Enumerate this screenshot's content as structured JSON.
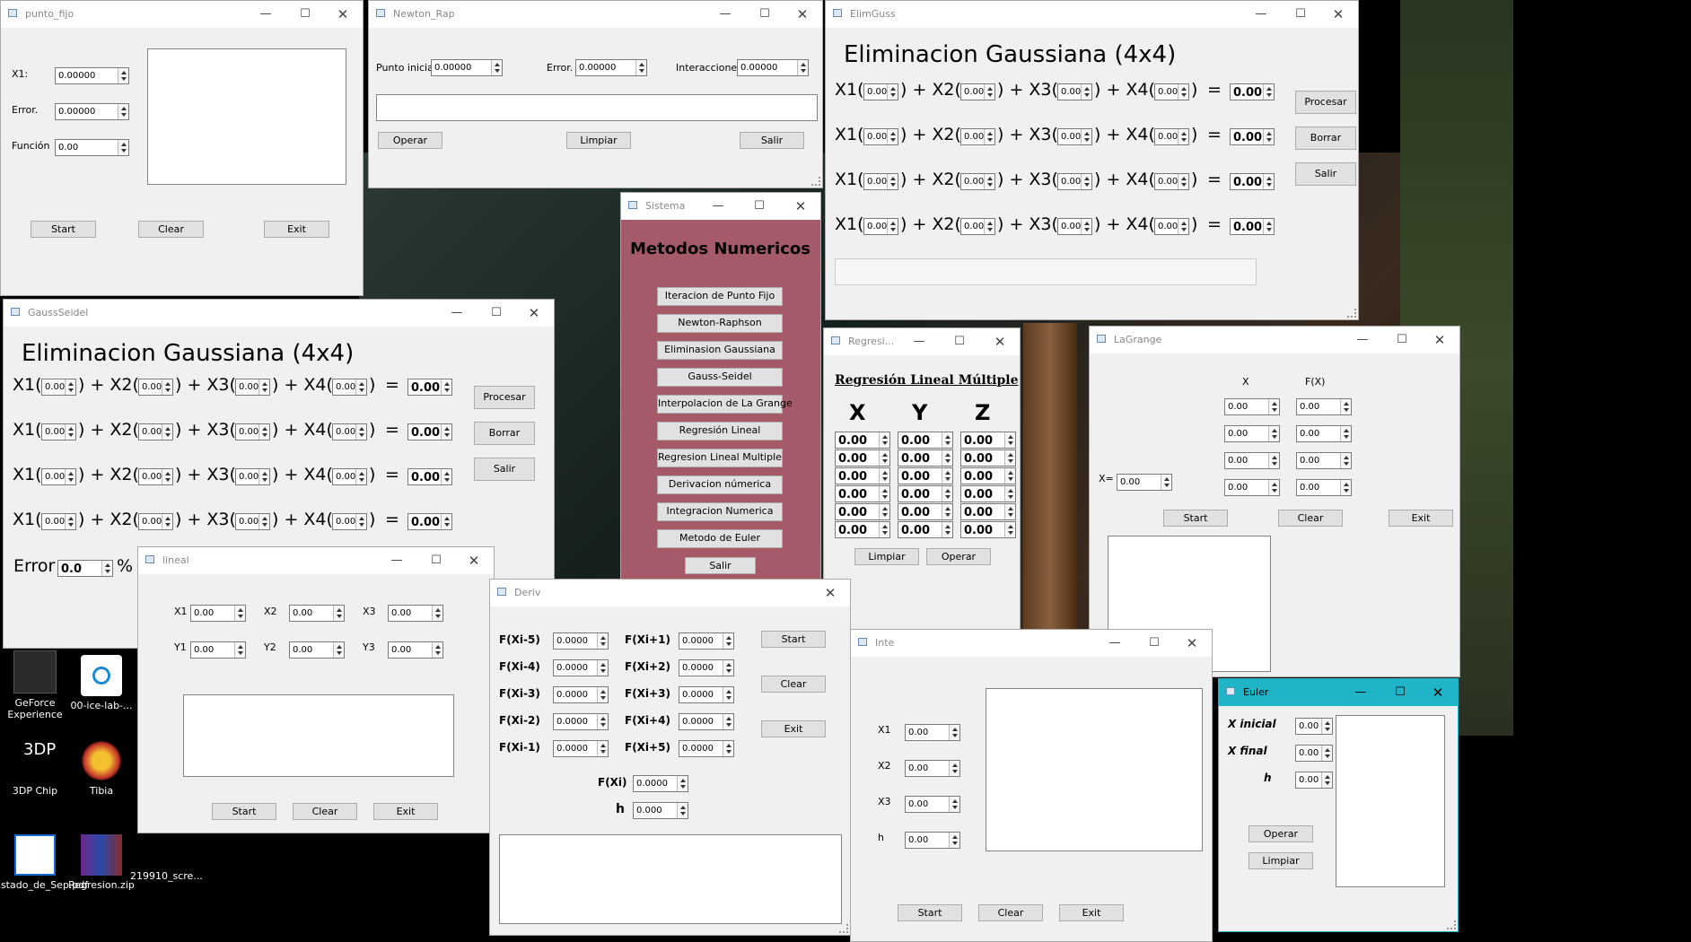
{
  "colors": {
    "sistema_bg": "#a55a6a",
    "euler_titlebar": "#1fb4c8",
    "window_bg": "#f0f0f0",
    "desktop": "#000000"
  },
  "punto_fijo": {
    "title": "punto_fijo",
    "x1_label": "X1:",
    "x1_value": "0.00000",
    "error_label": "Error.",
    "error_value": "0.00000",
    "funcion_label": "Función",
    "funcion_value": "0.00",
    "start": "Start",
    "clear": "Clear",
    "exit": "Exit"
  },
  "newton": {
    "title": "Newton_Rap",
    "punto_label": "Punto inicial",
    "punto_value": "0.00000",
    "error_label": "Error.",
    "error_value": "0.00000",
    "inter_label": "Interacciones",
    "inter_value": "0.00000",
    "operar": "Operar",
    "limpiar": "Limpiar",
    "salir": "Salir"
  },
  "elimguss": {
    "title": "ElimGuss",
    "heading": "Eliminacion Gaussiana (4x4)",
    "coef": "0.00",
    "result": "0.00",
    "procesar": "Procesar",
    "borrar": "Borrar",
    "salir": "Salir",
    "rows": [
      {
        "a": "X1(",
        "b": ") + X2(",
        "c": ") + X3(",
        "d": ") + X4(",
        "e": ")",
        "f": "="
      },
      {
        "a": "X1(",
        "b": ") + X2(",
        "c": ") + X3(",
        "d": ") + X4(",
        "e": ")",
        "f": "="
      },
      {
        "a": "X1(",
        "b": ") + X2(",
        "c": ") + X3(",
        "d": ") + X4(",
        "e": ")",
        "f": "="
      },
      {
        "a": "X1(",
        "b": ") + X2(",
        "c": ") + X3(",
        "d": ") + X4(",
        "e": ")",
        "f": "="
      }
    ]
  },
  "gauss_seidel": {
    "title": "GaussSeidel",
    "heading": "Eliminacion Gaussiana (4x4)",
    "coef": "0.00",
    "result": "0.00",
    "procesar": "Procesar",
    "borrar": "Borrar",
    "salir": "Salir",
    "error_label": "Error",
    "error_value": "0.0",
    "percent": "%",
    "rows": [
      {
        "a": "X1(",
        "b": ") + X2(",
        "c": ") + X3(",
        "d": ") + X4(",
        "e": ")",
        "f": "="
      },
      {
        "a": "X1(",
        "b": ") + X2(",
        "c": ") + X3(",
        "d": ") + X4(",
        "e": ")",
        "f": "="
      },
      {
        "a": "X1(",
        "b": ") + X2(",
        "c": ") + X3(",
        "d": ") + X4(",
        "e": ")",
        "f": "="
      },
      {
        "a": "X1(",
        "b": ") + X2(",
        "c": ") + X3(",
        "d": ") + X4(",
        "e": ")",
        "f": "="
      }
    ]
  },
  "sistema": {
    "title": "Sistema",
    "heading": "Metodos Numericos",
    "buttons": [
      "Iteracion de Punto Fijo",
      "Newton-Raphson",
      "Eliminasion Gaussiana",
      "Gauss-Seidel",
      "Interpolacion de La Grange",
      "Regresión Lineal",
      "Regresion Lineal Multiple",
      "Derivacion númerica",
      "Integracion Numerica",
      "Metodo de Euler"
    ],
    "salir": "Salir"
  },
  "regresion": {
    "title": "Regresi...",
    "heading": "Regresión Lineal Múltiple",
    "cols": [
      "X",
      "Y",
      "Z"
    ],
    "cell": "0.00",
    "limpiar": "Limpiar",
    "operar": "Operar"
  },
  "lagrange": {
    "title": "LaGrange",
    "x_header": "X",
    "fx_header": "F(X)",
    "cell": "0.00",
    "xeq_label": "X=",
    "xeq_value": "0.00",
    "start": "Start",
    "clear": "Clear",
    "exit": "Exit"
  },
  "lineal": {
    "title": "lineal",
    "x1": "X1",
    "x2": "X2",
    "x3": "X3",
    "y1": "Y1",
    "y2": "Y2",
    "y3": "Y3",
    "cell": "0.00",
    "start": "Start",
    "clear": "Clear",
    "exit": "Exit"
  },
  "deriv": {
    "title": "Deriv",
    "left": [
      "F(Xi-5)",
      "F(Xi-4)",
      "F(Xi-3)",
      "F(Xi-2)",
      "F(Xi-1)"
    ],
    "right": [
      "F(Xi+1)",
      "F(Xi+2)",
      "F(Xi+3)",
      "F(Xi+4)",
      "F(Xi+5)"
    ],
    "cell": "0.0000",
    "fxi_label": "F(Xi)",
    "fxi_value": "0.0000",
    "h_label": "h",
    "h_value": "0.000",
    "start": "Start",
    "clear": "Clear",
    "exit": "Exit"
  },
  "inte": {
    "title": "Inte",
    "x1": "X1",
    "x2": "X2",
    "x3": "X3",
    "h": "h",
    "cell": "0.00",
    "start": "Start",
    "clear": "Clear",
    "exit": "Exit"
  },
  "euler": {
    "title": "Euler",
    "xini_label": "X inicial",
    "xfin_label": "X final",
    "h_label": "h",
    "cell": "0.00",
    "operar": "Operar",
    "limpiar": "Limpiar"
  },
  "desktop": {
    "icons": [
      {
        "label": "GeForce Experience",
        "icon": "geforce-icon"
      },
      {
        "label": "00-ice-lab-...",
        "icon": "file-icon"
      },
      {
        "label": "3DP Chip",
        "icon": "3dp-chip-icon"
      },
      {
        "label": "Tibia",
        "icon": "tibia-icon"
      },
      {
        "label": "Estado_de_Sep.pdf",
        "icon": "pdf-icon"
      },
      {
        "label": "Regresion.zip",
        "icon": "zip-icon"
      },
      {
        "label": "219910_scre...",
        "icon": "image-icon"
      }
    ],
    "chip_text": "3DP"
  }
}
